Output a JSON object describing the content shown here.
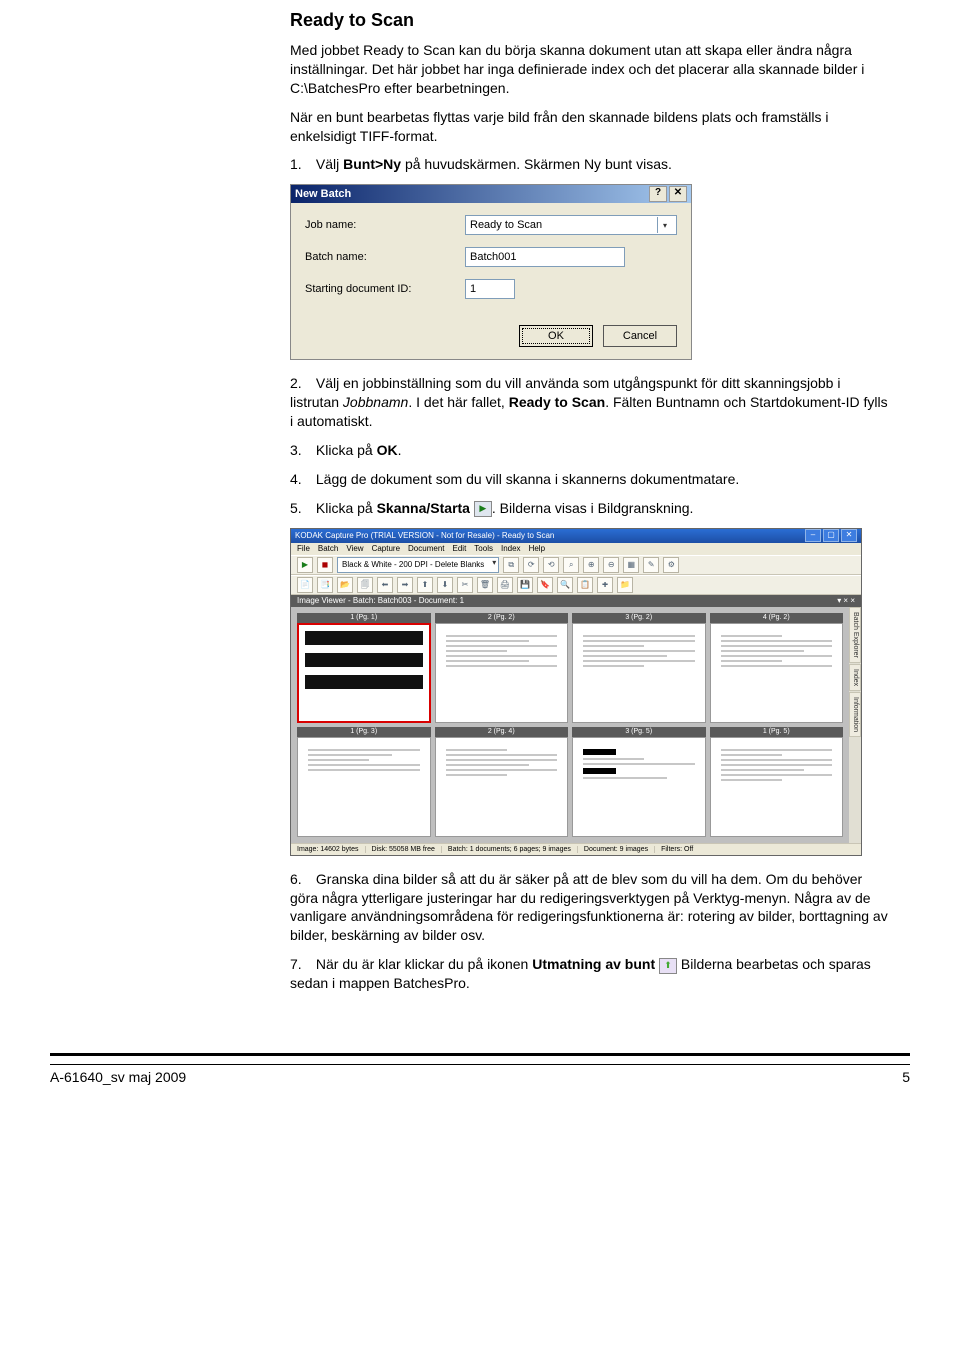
{
  "section": {
    "title": "Ready to Scan",
    "para1": "Med jobbet Ready to Scan kan du börja skanna dokument utan att skapa eller ändra några inställningar. Det här jobbet har inga definierade index och det placerar alla skannade bilder i C:\\BatchesPro efter bearbetningen.",
    "para2": "När en bunt bearbetas flyttas varje bild från den skannade bildens plats och framställs i enkelsidigt TIFF-format.",
    "step1_pre": "Välj ",
    "step1_bold": "Bunt>Ny",
    "step1_post": " på huvudskärmen. Skärmen Ny bunt visas.",
    "step2_pre": "Välj en jobbinställning som du vill använda som utgångspunkt för ditt skanningsjobb i listrutan ",
    "step2_it": "Jobbnamn",
    "step2_mid": ". I det här fallet, ",
    "step2_bold": "Ready to Scan",
    "step2_post": ". Fälten Buntnamn och Startdokument-ID fylls i automatiskt.",
    "step3_pre": "Klicka på ",
    "step3_bold": "OK",
    "step3_post": ".",
    "step4": "Lägg de dokument som du vill skanna i skannerns dokumentmatare.",
    "step5_pre": "Klicka på ",
    "step5_bold": "Skanna/Starta",
    "step5_post": ". Bilderna visas i Bildgranskning.",
    "step6": "Granska dina bilder så att du är säker på att de blev som du vill ha dem. Om du behöver göra några ytterligare justeringar har du redigeringsverktygen på Verktyg-menyn. Några av de vanligare användningsområdena för redigeringsfunktionerna är: rotering av bilder, borttagning av bilder, beskärning av bilder osv.",
    "step7_pre": "När du är klar klickar du på ikonen ",
    "step7_bold": "Utmatning av bunt",
    "step7_post": "  Bilderna bearbetas och sparas sedan i mappen BatchesPro."
  },
  "dialog": {
    "title": "New Batch",
    "help_glyph": "?",
    "close_glyph": "✕",
    "job_label": "Job name:",
    "job_value": "Ready to Scan",
    "batch_label": "Batch name:",
    "batch_value": "Batch001",
    "start_label": "Starting document ID:",
    "start_value": "1",
    "ok": "OK",
    "cancel": "Cancel"
  },
  "app": {
    "title": "KODAK Capture Pro (TRIAL VERSION - Not for Resale) - Ready to Scan",
    "menus": [
      "File",
      "Batch",
      "View",
      "Capture",
      "Document",
      "Edit",
      "Tools",
      "Index",
      "Help"
    ],
    "combo": "Black & White - 200 DPI - Delete Blanks",
    "viewer_header_left": "Image Viewer - Batch: Batch003 - Document: 1",
    "viewer_header_right": "▾ × ×",
    "cells_row1": [
      "1 (Pg. 1)",
      "2 (Pg. 2)",
      "3 (Pg. 2)",
      "4 (Pg. 2)"
    ],
    "cells_row2": [
      "1 (Pg. 3)",
      "2 (Pg. 4)",
      "3 (Pg. 5)",
      "1 (Pg. 5)"
    ],
    "side_tabs": [
      "Batch Explorer",
      "Index",
      "Information"
    ],
    "status": [
      "Image: 14602 bytes",
      "Disk: 55058 MB free",
      "Batch: 1 documents; 6 pages; 9 images",
      "Document: 9 images",
      "Filters: Off"
    ]
  },
  "icons": {
    "play": "▶",
    "output": "⬆"
  },
  "footer": {
    "left": "A-61640_sv  maj 2009",
    "right": "5"
  }
}
